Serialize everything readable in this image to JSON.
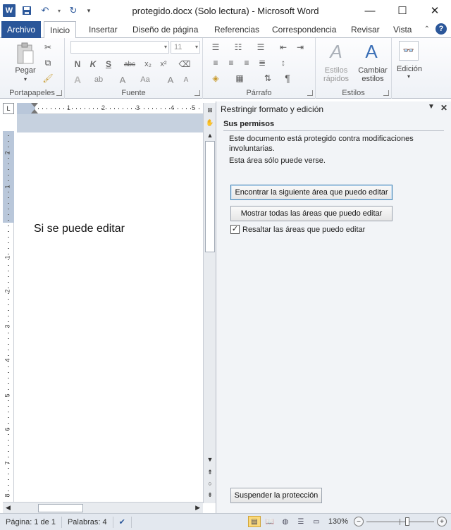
{
  "window": {
    "title": "protegido.docx (Solo lectura)  -  Microsoft Word",
    "app_icon_letter": "W"
  },
  "tabs": [
    {
      "label": "Archivo"
    },
    {
      "label": "Inicio"
    },
    {
      "label": "Insertar"
    },
    {
      "label": "Diseño de página"
    },
    {
      "label": "Referencias"
    },
    {
      "label": "Correspondencia"
    },
    {
      "label": "Revisar"
    },
    {
      "label": "Vista"
    }
  ],
  "ribbon": {
    "clipboard": {
      "label": "Portapapeles",
      "paste_label": "Pegar"
    },
    "font": {
      "label": "Fuente",
      "font_name": "",
      "font_size": "11",
      "bold": "N",
      "italic": "K",
      "underline": "S",
      "strike": "abc",
      "sub": "x₂",
      "sup": "x²",
      "grow": "A",
      "case": "Aa"
    },
    "paragraph": {
      "label": "Párrafo",
      "pilcrow": "¶"
    },
    "styles": {
      "label": "Estilos",
      "quick_styles_line1": "Estilos",
      "quick_styles_line2": "rápidos",
      "change_styles_line1": "Cambiar",
      "change_styles_line2": "estilos"
    },
    "editing": {
      "label": "Edición"
    }
  },
  "document": {
    "text": "Si se puede editar"
  },
  "ruler": {
    "h_numbers": [
      "1",
      "2",
      "3",
      "4",
      "5"
    ],
    "v_numbers": [
      "2",
      "1",
      "1",
      "2",
      "3",
      "4",
      "5",
      "6",
      "7",
      "8"
    ]
  },
  "pane": {
    "title": "Restringir formato y edición",
    "section_title": "Sus permisos",
    "text1": "Este documento está protegido contra modificaciones involuntarias.",
    "text2": "Esta área sólo puede verse.",
    "btn_find_next": "Encontrar la siguiente área que puedo editar",
    "btn_show_all": "Mostrar todas las áreas que puedo editar",
    "checkbox_label": "Resaltar las áreas que puedo editar",
    "checkbox_checked": true,
    "btn_stop": "Suspender la protección"
  },
  "status": {
    "page": "Página: 1 de 1",
    "words": "Palabras: 4",
    "zoom": "130%",
    "zoom_level": 130
  }
}
